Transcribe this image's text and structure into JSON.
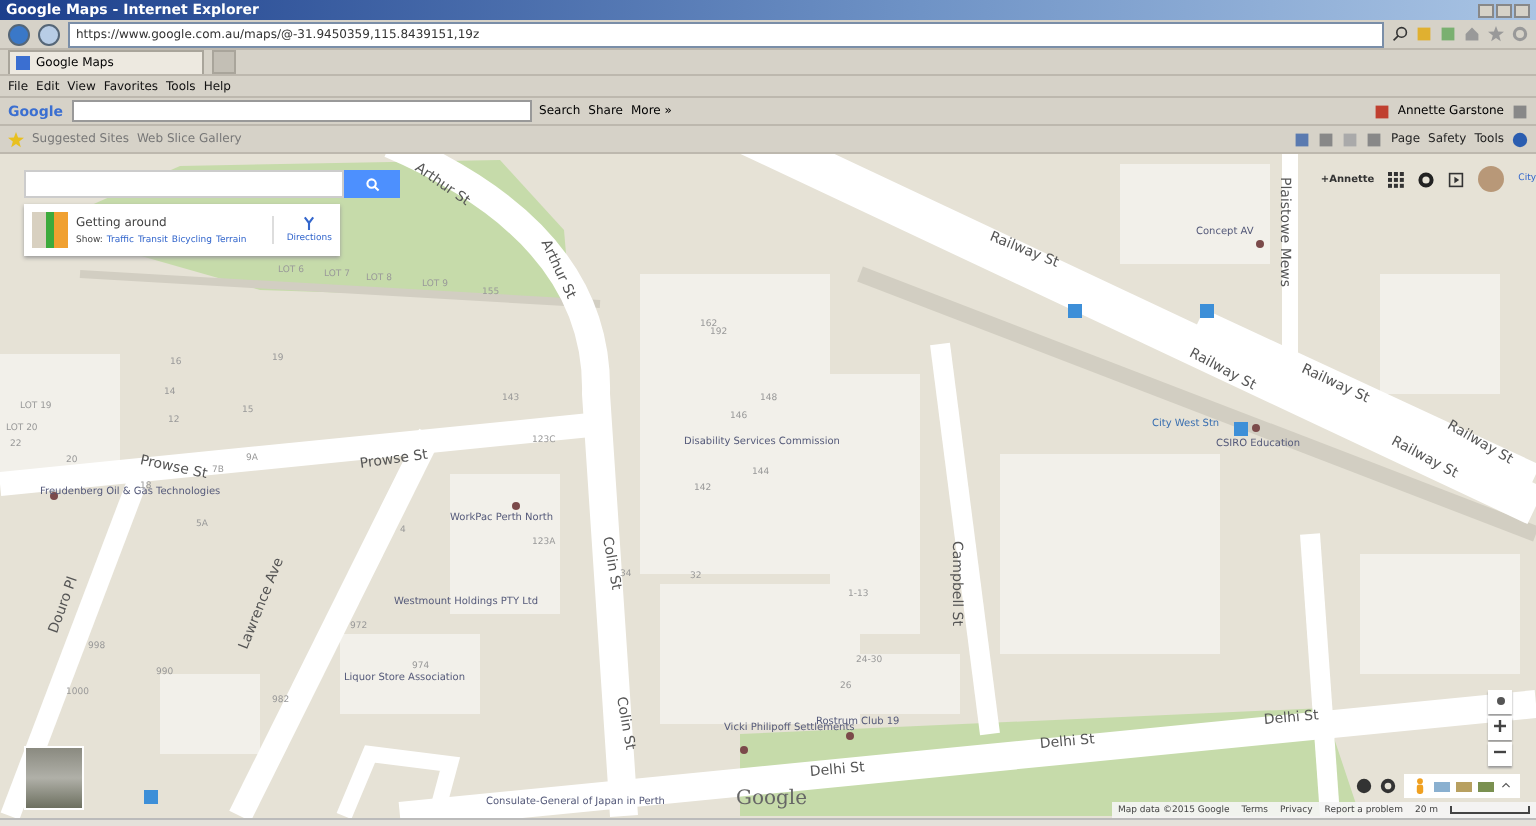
{
  "window": {
    "title": "Google Maps - Internet Explorer"
  },
  "address_bar": {
    "url": "https://www.google.com.au/maps/@-31.9450359,115.8439151,19z"
  },
  "tabs": [
    {
      "label": "Google Maps",
      "selected": true
    }
  ],
  "menu": [
    "File",
    "Edit",
    "View",
    "Favorites",
    "Tools",
    "Help"
  ],
  "google_toolbar": {
    "logo": "Google",
    "buttons": [
      "Search",
      "Share",
      "More »"
    ],
    "user": "Annette Garstone"
  },
  "favorites_bar": {
    "items": [
      "Suggested Sites",
      "Web Slice Gallery"
    ],
    "commands": [
      "Page",
      "Safety",
      "Tools"
    ]
  },
  "map": {
    "getting_around": {
      "title": "Getting around",
      "show_label": "Show:",
      "layers": [
        "Traffic",
        "Transit",
        "Bicycling",
        "Terrain"
      ],
      "directions": "Directions"
    },
    "account": {
      "name": "+Annette",
      "cut_text": "City"
    },
    "labels": [
      {
        "kind": "street",
        "text": "Arthur St"
      },
      {
        "kind": "street",
        "text": "Arthur St"
      },
      {
        "kind": "street",
        "text": "Railway St"
      },
      {
        "kind": "street",
        "text": "Railway St"
      },
      {
        "kind": "street",
        "text": "Railway St"
      },
      {
        "kind": "street",
        "text": "Railway St"
      },
      {
        "kind": "street",
        "text": "Railway St"
      },
      {
        "kind": "street",
        "text": "Plaistowe Mews"
      },
      {
        "kind": "street",
        "text": "Prowse St"
      },
      {
        "kind": "street",
        "text": "Prowse St"
      },
      {
        "kind": "street",
        "text": "Douro Pl"
      },
      {
        "kind": "street",
        "text": "Lawrence Ave"
      },
      {
        "kind": "street",
        "text": "Colin St"
      },
      {
        "kind": "street",
        "text": "Colin St"
      },
      {
        "kind": "street",
        "text": "Campbell St"
      },
      {
        "kind": "street",
        "text": "Delhi St"
      },
      {
        "kind": "street",
        "text": "Delhi St"
      },
      {
        "kind": "street",
        "text": "Delhi St"
      },
      {
        "kind": "place",
        "text": "Freudenberg Oil & Gas Technologies"
      },
      {
        "kind": "place",
        "text": "WorkPac Perth North"
      },
      {
        "kind": "place",
        "text": "Westmount Holdings PTY Ltd"
      },
      {
        "kind": "place",
        "text": "Liquor Store Association"
      },
      {
        "kind": "place",
        "text": "Consulate-General of Japan in Perth"
      },
      {
        "kind": "place",
        "text": "Vicki Philipoff Settlements"
      },
      {
        "kind": "place",
        "text": "Rostrum Club 19"
      },
      {
        "kind": "place",
        "text": "Disability Services Commission"
      },
      {
        "kind": "place",
        "text": "Concept AV"
      },
      {
        "kind": "transit",
        "text": "City West Stn"
      },
      {
        "kind": "place",
        "text": "CSIRO Education"
      },
      {
        "kind": "lot",
        "text": "LOT 6"
      },
      {
        "kind": "lot",
        "text": "LOT 7"
      },
      {
        "kind": "lot",
        "text": "LOT 8"
      },
      {
        "kind": "lot",
        "text": "LOT 9"
      },
      {
        "kind": "lot",
        "text": "155"
      },
      {
        "kind": "lot",
        "text": "162"
      },
      {
        "kind": "lot",
        "text": "22"
      },
      {
        "kind": "lot",
        "text": "20"
      },
      {
        "kind": "lot",
        "text": "18"
      },
      {
        "kind": "lot",
        "text": "16"
      },
      {
        "kind": "lot",
        "text": "14"
      },
      {
        "kind": "lot",
        "text": "12"
      },
      {
        "kind": "lot",
        "text": "19"
      },
      {
        "kind": "lot",
        "text": "15"
      },
      {
        "kind": "lot",
        "text": "9A"
      },
      {
        "kind": "lot",
        "text": "7B"
      },
      {
        "kind": "lot",
        "text": "5A"
      },
      {
        "kind": "lot",
        "text": "LOT 19"
      },
      {
        "kind": "lot",
        "text": "LOT 20"
      },
      {
        "kind": "lot",
        "text": "1000"
      },
      {
        "kind": "lot",
        "text": "998"
      },
      {
        "kind": "lot",
        "text": "990"
      },
      {
        "kind": "lot",
        "text": "982"
      },
      {
        "kind": "lot",
        "text": "972"
      },
      {
        "kind": "lot",
        "text": "974"
      },
      {
        "kind": "lot",
        "text": "143"
      },
      {
        "kind": "lot",
        "text": "123C"
      },
      {
        "kind": "lot",
        "text": "123A"
      },
      {
        "kind": "lot",
        "text": "148"
      },
      {
        "kind": "lot",
        "text": "146"
      },
      {
        "kind": "lot",
        "text": "144"
      },
      {
        "kind": "lot",
        "text": "142"
      },
      {
        "kind": "lot",
        "text": "34"
      },
      {
        "kind": "lot",
        "text": "32"
      },
      {
        "kind": "lot",
        "text": "1-13"
      },
      {
        "kind": "lot",
        "text": "24-30"
      },
      {
        "kind": "lot",
        "text": "26"
      },
      {
        "kind": "lot",
        "text": "4"
      },
      {
        "kind": "lot",
        "text": "192"
      }
    ],
    "logo": "Google",
    "footer": [
      "Map data ©2015 Google",
      "Terms",
      "Privacy",
      "Report a problem"
    ],
    "scale": "20 m"
  }
}
